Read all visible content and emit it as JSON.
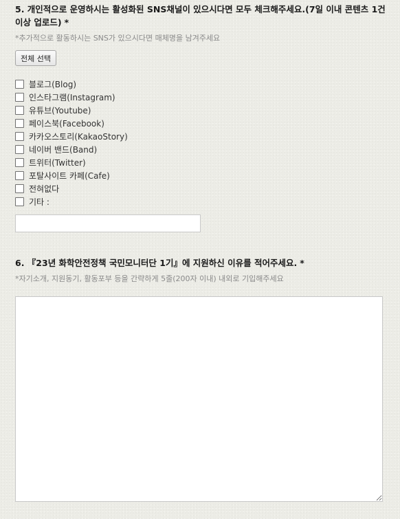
{
  "question5": {
    "title": "5. 개인적으로 운영하시는 활성화된 SNS채널이 있으시다면 모두 체크해주세요.(7일 이내 콘텐츠 1건 이상 업로드)",
    "required_mark": "*",
    "subtitle": "*추가적으로 활동하시는 SNS가 있으시다면 매체명을 남겨주세요",
    "select_all_label": "전체 선택",
    "options": [
      {
        "label": "블로그(Blog)",
        "checked": false
      },
      {
        "label": "인스타그램(Instagram)",
        "checked": false
      },
      {
        "label": "유튜브(Youtube)",
        "checked": false
      },
      {
        "label": "페이스북(Facebook)",
        "checked": false
      },
      {
        "label": "카카오스토리(KakaoStory)",
        "checked": false
      },
      {
        "label": "네이버 밴드(Band)",
        "checked": false
      },
      {
        "label": "트위터(Twitter)",
        "checked": false
      },
      {
        "label": "포탈사이트 카페(Cafe)",
        "checked": false
      },
      {
        "label": "전혀없다",
        "checked": false
      },
      {
        "label": "기타 :",
        "checked": false
      }
    ],
    "other_value": ""
  },
  "question6": {
    "title": "6. 『23년 화학안전정책 국민모니터단 1기』에 지원하신 이유를 적어주세요.",
    "required_mark": "*",
    "subtitle": "*자기소개, 지원동기, 활동포부 등을 간략하게 5줄(200자 이내) 내외로 기입해주세요",
    "answer_value": ""
  }
}
